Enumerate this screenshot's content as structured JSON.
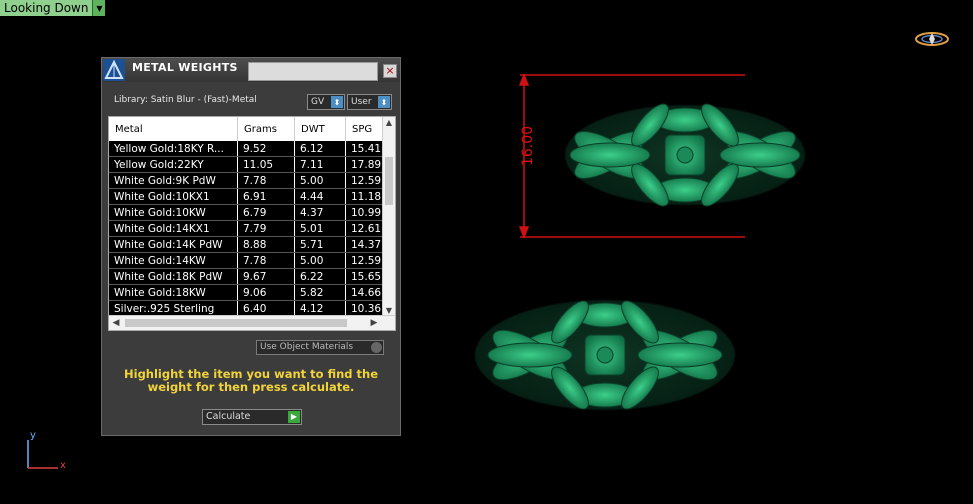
{
  "viewport": {
    "label": "Looking Down",
    "axis_x": "x",
    "axis_y": "y",
    "dimension_value": "16.00",
    "dimension_color": "#d11111",
    "model_color": "#1f9a64"
  },
  "panel": {
    "title": "METAL WEIGHTS",
    "close_icon": "×",
    "library_text": "Library: Satin Blur - (Fast)-Metal",
    "gv_label": "GV",
    "user_label": "User",
    "table": {
      "columns": [
        "Metal",
        "Grams",
        "DWT",
        "SPG"
      ],
      "rows": [
        {
          "metal": "Yellow Gold:18KY R...",
          "grams": "9.52",
          "dwt": "6.12",
          "spg": "15.41"
        },
        {
          "metal": "Yellow Gold:22KY",
          "grams": "11.05",
          "dwt": "7.11",
          "spg": "17.89"
        },
        {
          "metal": "White Gold:9K PdW",
          "grams": "7.78",
          "dwt": "5.00",
          "spg": "12.59"
        },
        {
          "metal": "White Gold:10KX1",
          "grams": "6.91",
          "dwt": "4.44",
          "spg": "11.18"
        },
        {
          "metal": "White Gold:10KW",
          "grams": "6.79",
          "dwt": "4.37",
          "spg": "10.99"
        },
        {
          "metal": "White Gold:14KX1",
          "grams": "7.79",
          "dwt": "5.01",
          "spg": "12.61"
        },
        {
          "metal": "White Gold:14K PdW",
          "grams": "8.88",
          "dwt": "5.71",
          "spg": "14.37"
        },
        {
          "metal": "White Gold:14KW",
          "grams": "7.78",
          "dwt": "5.00",
          "spg": "12.59"
        },
        {
          "metal": "White Gold:18K PdW",
          "grams": "9.67",
          "dwt": "6.22",
          "spg": "15.65"
        },
        {
          "metal": "White Gold:18KW",
          "grams": "9.06",
          "dwt": "5.82",
          "spg": "14.66"
        },
        {
          "metal": "Silver:.925 Sterling",
          "grams": "6.40",
          "dwt": "4.12",
          "spg": "10.36"
        }
      ]
    },
    "use_object_materials": "Use Object Materials",
    "hint": "Highlight the item you want to find the weight for then press calculate.",
    "calculate_label": "Calculate"
  }
}
